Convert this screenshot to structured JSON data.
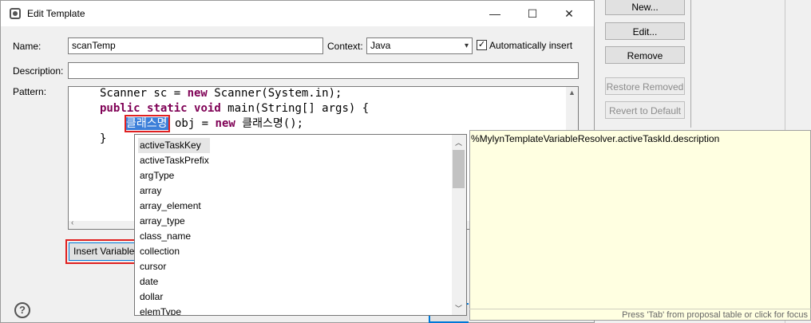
{
  "window": {
    "title": "Edit Template",
    "minimize_glyph": "—",
    "maximize_glyph": "☐",
    "close_glyph": "✕"
  },
  "form": {
    "name_label": "Name:",
    "name_value": "scanTemp",
    "context_label": "Context:",
    "context_value": "Java",
    "auto_insert_label": "Automatically insert",
    "auto_insert_checked": true,
    "description_label": "Description:",
    "description_value": "",
    "pattern_label": "Pattern:"
  },
  "pattern": {
    "line1_plain1": "Scanner sc = ",
    "line1_kw": "new",
    "line1_plain2": " Scanner(System.in);",
    "line2_kw1": "public",
    "line2_kw2": "static",
    "line2_kw3": "void",
    "line2_plain": " main(String[] args) {",
    "line3_var": "클래스명",
    "line3_plain1": " obj = ",
    "line3_kw": "new",
    "line3_plain2": " 클래스명();",
    "line4": "}"
  },
  "buttons": {
    "insert_variable": "Insert Variable...",
    "help": "?"
  },
  "background_buttons": {
    "new": "New...",
    "edit": "Edit...",
    "remove": "Remove",
    "restore_removed": "Restore Removed",
    "revert_to_default": "Revert to Default"
  },
  "proposals": {
    "items": [
      "activeTaskKey",
      "activeTaskPrefix",
      "argType",
      "array",
      "array_element",
      "array_type",
      "class_name",
      "collection",
      "cursor",
      "date",
      "dollar",
      "elemType"
    ],
    "selected_index": 0
  },
  "info_popup": {
    "text": "%MylynTemplateVariableResolver.activeTaskId.description",
    "status": "Press 'Tab' from proposal table or click for focus"
  },
  "colors": {
    "keyword": "#7f0055",
    "highlight": "#3c7fd9",
    "callout_border": "#e02020",
    "info_background": "#ffffe1"
  }
}
